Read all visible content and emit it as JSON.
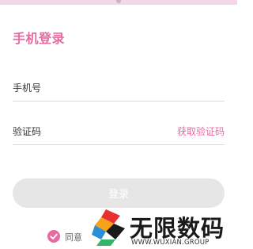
{
  "page": {
    "title": "手机登录"
  },
  "form": {
    "phone_label": "手机号",
    "phone_value": "",
    "code_label": "验证码",
    "code_value": "",
    "get_code_label": "获取验证码",
    "login_label": "登录"
  },
  "agreement": {
    "text": "同意",
    "checked": true,
    "check_icon": "check-circle-icon"
  },
  "watermark": {
    "title": "无限数码",
    "subtitle": "WWW.WUXIAN.GROUP",
    "logo_icon": "wuxian-logo"
  },
  "colors": {
    "accent": "#e76aa3",
    "button_disabled": "#e6e6e6",
    "top_strip": "#f3d7e6"
  }
}
